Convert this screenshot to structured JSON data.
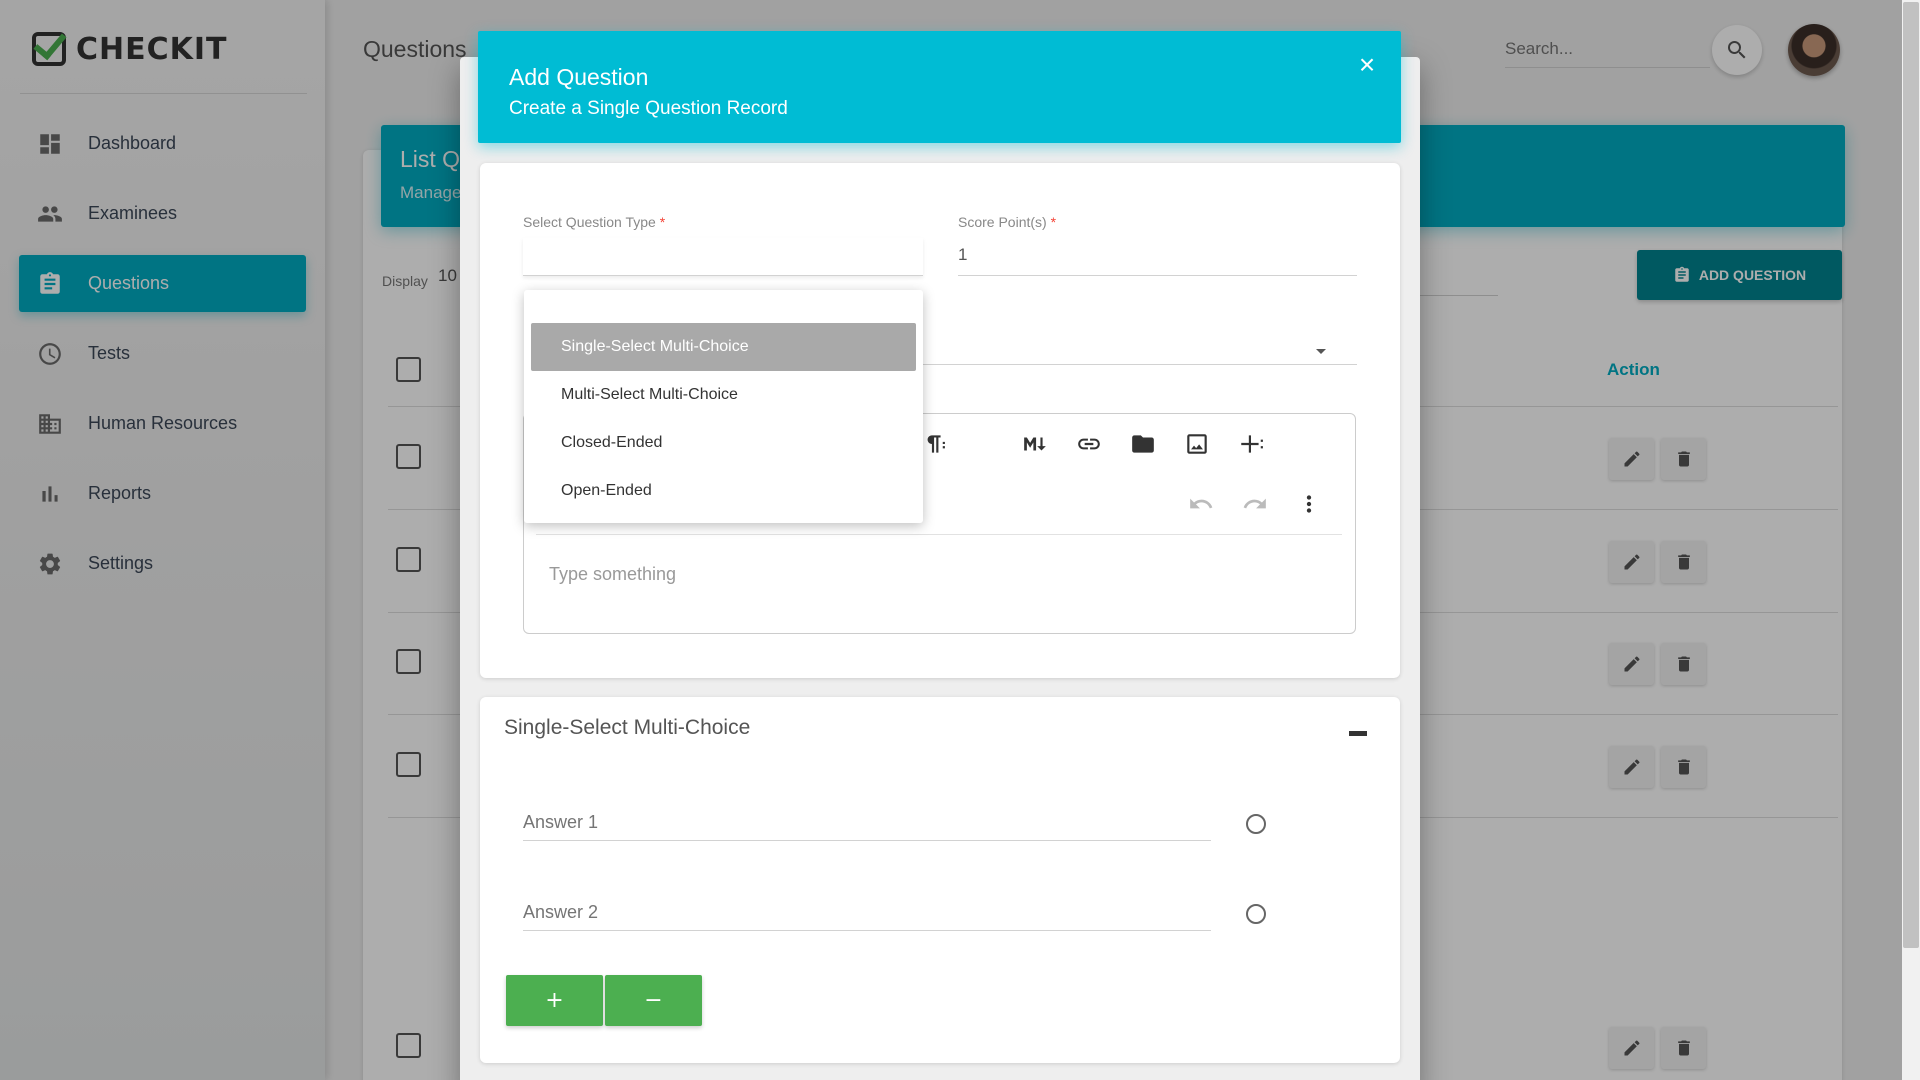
{
  "app": {
    "logo_text": "CHECKIT"
  },
  "sidebar": {
    "items": [
      {
        "label": "Dashboard",
        "icon": "dashboard-icon"
      },
      {
        "label": "Examinees",
        "icon": "people-icon"
      },
      {
        "label": "Questions",
        "icon": "clipboard-icon",
        "active": true
      },
      {
        "label": "Tests",
        "icon": "clock-icon"
      },
      {
        "label": "Human Resources",
        "icon": "building-icon"
      },
      {
        "label": "Reports",
        "icon": "bar-chart-icon"
      },
      {
        "label": "Settings",
        "icon": "gear-icon"
      }
    ]
  },
  "header": {
    "page_title": "Questions",
    "search_placeholder": "Search..."
  },
  "list": {
    "title": "List Q",
    "subtitle": "Manage",
    "display_label": "Display",
    "display_value": "10",
    "add_question_label": "ADD QUESTION",
    "action_header": "Action"
  },
  "modal": {
    "title": "Add Question",
    "subtitle": "Create a Single Question Record",
    "close_label": "×",
    "question_type_label": "Select Question Type",
    "score_label": "Score Point(s)",
    "score_value": "1",
    "required_mark": "*",
    "editor_placeholder": "Type something",
    "question_type_options": [
      "Single-Select Multi-Choice",
      "Multi-Select Multi-Choice",
      "Closed-Ended",
      "Open-Ended"
    ],
    "selected_option": "Single-Select Multi-Choice",
    "answers_section_title": "Single-Select Multi-Choice",
    "answers": [
      {
        "placeholder": "Answer 1"
      },
      {
        "placeholder": "Answer 2"
      }
    ],
    "add_answer_label": "+",
    "remove_answer_label": "−"
  },
  "colors": {
    "accent": "#00bcd4",
    "accent_dark": "#00838f",
    "success": "#4caf50",
    "active_nav": "#00acc1"
  }
}
